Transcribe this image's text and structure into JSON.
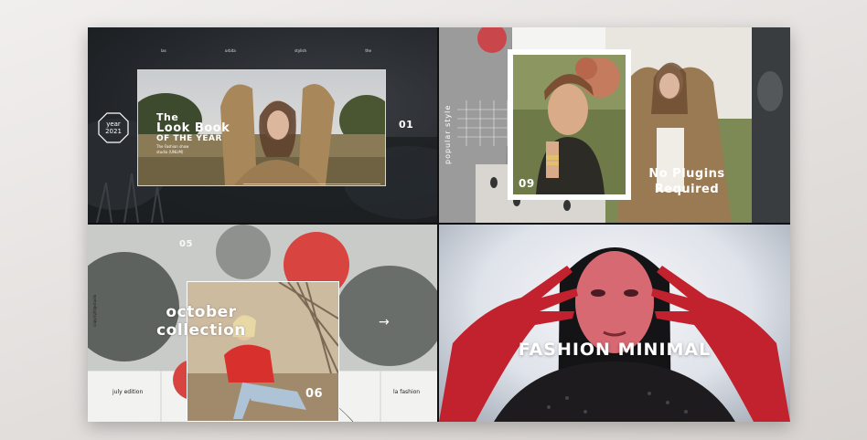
{
  "panel1": {
    "nav": [
      "las",
      "orbita",
      "stylish",
      "the"
    ],
    "badge_line1": "year",
    "badge_line2": "2021",
    "title_line1": "The",
    "title_line2": "Look Book",
    "title_line3": "OF THE YEAR",
    "sub_line1": "The Fashion show",
    "sub_line2": "studio (UNLIM)",
    "number": "01"
  },
  "panel2": {
    "vertical_label": "popular style",
    "number": "09",
    "headline_line1": "No Plugins",
    "headline_line2": "Required"
  },
  "panel3": {
    "top_number": "05",
    "vertical_label": "copyright@studio",
    "title_line1": "october",
    "title_line2": "collection",
    "number": "06",
    "left_caption": "july edition",
    "right_caption": "la fashion"
  },
  "panel4": {
    "headline": "FASHION MINIMAL"
  },
  "colors": {
    "accent_red": "#d8443f",
    "dark_panel": "#22262a"
  }
}
